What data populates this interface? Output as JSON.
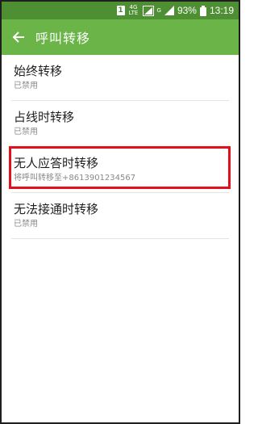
{
  "status_bar": {
    "sim_label": "1",
    "network_top": "4G",
    "network_bottom": "LTE",
    "extra_signal": "G",
    "battery_percent": "93%",
    "time": "13:19"
  },
  "app_bar": {
    "back_icon": "arrow-left-icon",
    "title": "呼叫转移"
  },
  "settings": [
    {
      "title": "始终转移",
      "subtitle": "已禁用"
    },
    {
      "title": "占线时转移",
      "subtitle": "已禁用"
    },
    {
      "title": "无人应答时转移",
      "subtitle": "将呼叫转移至+8613901234567"
    },
    {
      "title": "无法接通时转移",
      "subtitle": "已禁用"
    }
  ],
  "colors": {
    "status_bar": "#4e8f34",
    "app_bar": "#6bb548",
    "highlight_border": "#e2101b"
  }
}
